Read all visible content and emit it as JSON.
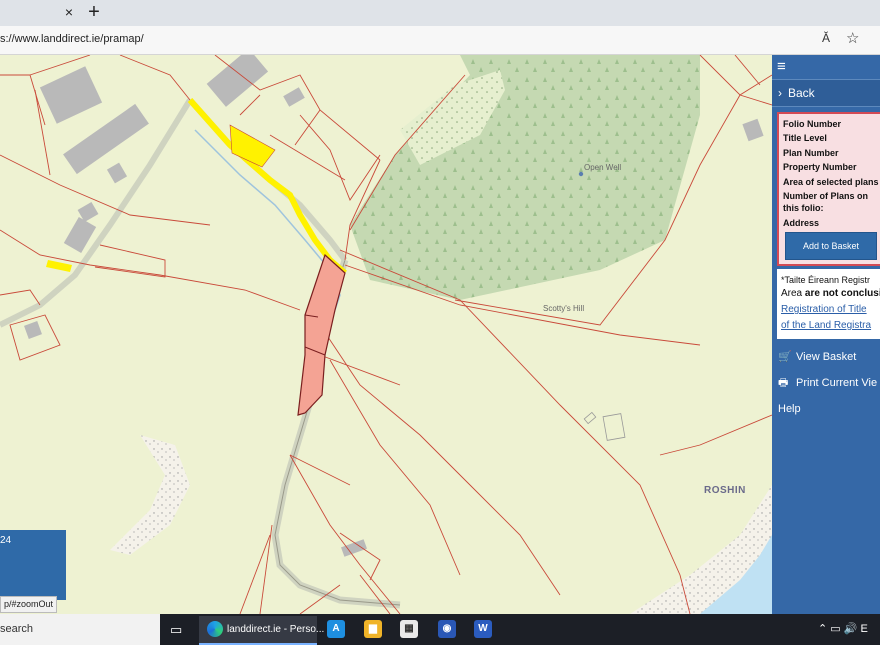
{
  "browser": {
    "tab_close": "×",
    "tab_new": "+",
    "url": "s://www.landdirect.ie/pramap/",
    "read_aloud": "Ă",
    "favorite": "☆"
  },
  "map": {
    "labels": {
      "open_well": "Open Well",
      "scottys_hill": "Scotty's Hill",
      "roshin": "ROSHIN"
    },
    "scale_text": "24",
    "status_url": "p/#zoomOut",
    "colors": {
      "background": "#eef2d2",
      "boundary": "#c94a3a",
      "selected_parcel": "#f4a394",
      "highlight": "#fff200",
      "forest": "#c3d8b0",
      "water": "#bfe1f3",
      "building": "#b9b9b9"
    }
  },
  "panel": {
    "menu_icon": "≡",
    "back_chevron": "›",
    "back_label": "Back",
    "info": {
      "folio_number": "Folio Number",
      "title_level": "Title Level",
      "plan_number": "Plan Number",
      "property_number": "Property Number",
      "area": "Area of selected plans",
      "plans_on_folio_1": "Number of Plans on",
      "plans_on_folio_2": "this folio:",
      "address": "Address",
      "add_to_basket": "Add to Basket"
    },
    "notice": {
      "line1": "*Tailte Éireann Registr",
      "line2_prefix": "Area ",
      "line2_bold": "are not conclusi",
      "link1": "Registration of Title",
      "link2": "of the Land Registra"
    },
    "view_basket": "View Basket",
    "print_view": "Print Current Vie",
    "help": "Help",
    "colors": {
      "panel": "#3568a7",
      "info_bg": "#f8dfe2",
      "info_border": "#d34a55"
    }
  },
  "taskbar": {
    "search": "search",
    "edge_label": "landdirect.ie - Perso...",
    "tray": "⌃  ▭  🔊  E"
  }
}
